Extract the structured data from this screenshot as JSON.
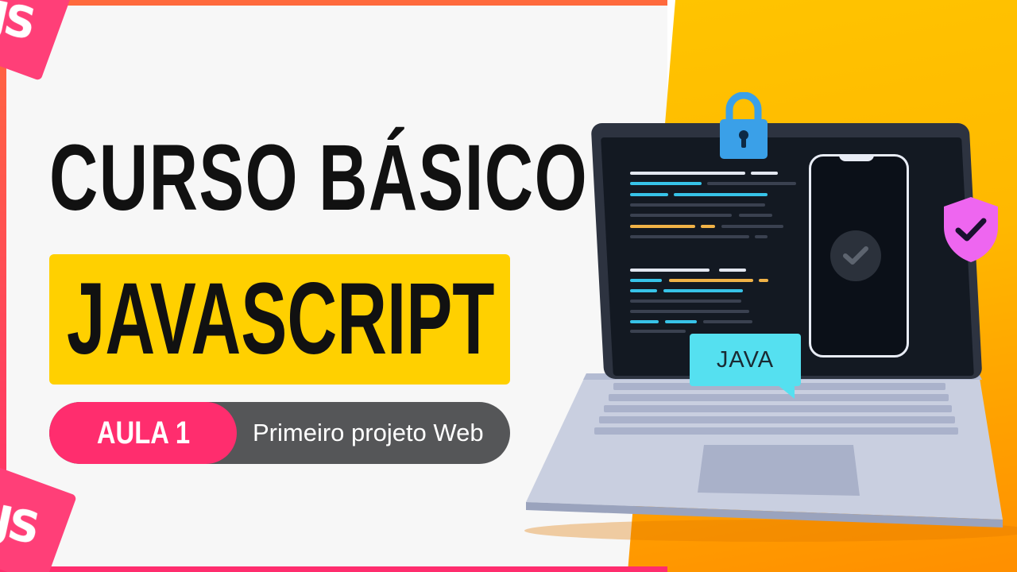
{
  "title_line1": "CURSO BÁSICO",
  "title_line2": "JAVASCRIPT",
  "lesson_label": "AULA 1",
  "lesson_title": "Primeiro projeto Web",
  "js_logo_text": "JS",
  "tag_text": "JAVA",
  "icons": {
    "lock": "padlock-icon",
    "shield": "shield-check-icon",
    "check": "checkmark-icon"
  },
  "colors": {
    "accent_yellow": "#ffd000",
    "accent_pink": "#ff2d6e",
    "pill_gray": "#555658",
    "tag_cyan": "#55e0f0",
    "lock_blue": "#3aa0e8",
    "shield_pink": "#ee66f0"
  }
}
